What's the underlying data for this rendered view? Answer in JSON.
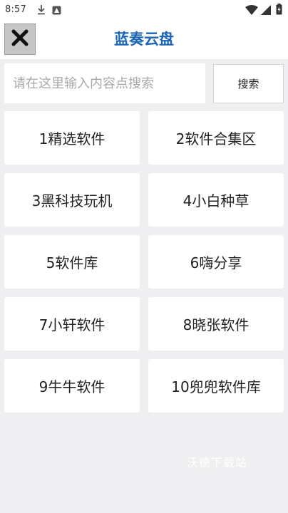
{
  "status_bar": {
    "time": "8:57",
    "icons": [
      "download-icon",
      "notification-icon",
      "wifi-icon",
      "signal-icon",
      "battery-icon"
    ]
  },
  "app_bar": {
    "close_icon": "close-icon",
    "title": "蓝奏云盘",
    "title_color": "#1865b8"
  },
  "search": {
    "placeholder": "请在这里输入内容点搜索",
    "value": "",
    "button_label": "搜索"
  },
  "tiles": [
    {
      "label": "1精选软件"
    },
    {
      "label": "2软件合集区"
    },
    {
      "label": "3黑科技玩机"
    },
    {
      "label": "4小白种草"
    },
    {
      "label": "5软件库"
    },
    {
      "label": "6嗨分享"
    },
    {
      "label": "7小轩软件"
    },
    {
      "label": "8晓张软件"
    },
    {
      "label": "9牛牛软件"
    },
    {
      "label": "10兜兜软件库"
    }
  ],
  "watermark": "沃德下载站"
}
